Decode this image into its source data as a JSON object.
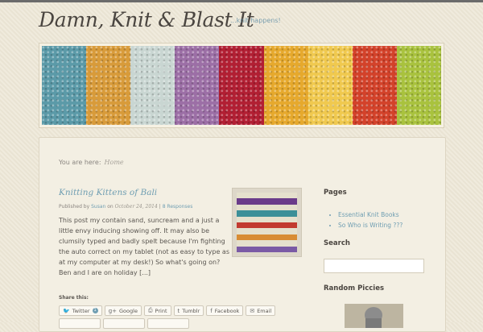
{
  "site": {
    "title": "Damn, Knit & Blast It",
    "tagline": "...knit happens!"
  },
  "banner": {
    "tiles": [
      "#5b9aa8",
      "#d89b3a",
      "#c9d6d2",
      "#9c6fa6",
      "#b21f33",
      "#e6a92d",
      "#f0c94f",
      "#d3422a",
      "#a9c23e"
    ]
  },
  "breadcrumb": {
    "prefix": "You are here:",
    "home": "Home"
  },
  "post": {
    "title": "Knitting Kittens of Bali",
    "meta": {
      "published_by": "Published by",
      "author": "Susan",
      "on": "on",
      "date": "October 24, 2014",
      "separator": "|",
      "responses": "8 Responses"
    },
    "excerpt": "This post my contain sand, suncream and a just a little envy inducing showing off. It may also be clumsily typed and badly spelt because I'm fighting the auto correct on my tablet (not as easy to type as at my computer at my desk!) So what's going on? Ben and I are on holiday [...]",
    "thumb_stripes": [
      "#e5e0cd",
      "#6a3b8a",
      "#e5e0cd",
      "#3c8f98",
      "#e5e0cd",
      "#c23a30",
      "#e5e0cd",
      "#d88c34",
      "#e5e0cd",
      "#7a5aa5"
    ]
  },
  "share": {
    "label": "Share this:",
    "buttons": [
      {
        "label": "Twitter",
        "icon": "twitter-icon",
        "glyph": "🐦",
        "count": "1"
      },
      {
        "label": "Google",
        "icon": "google-plus-icon",
        "glyph": "g+"
      },
      {
        "label": "Print",
        "icon": "printer-icon",
        "glyph": "⎙"
      },
      {
        "label": "Tumblr",
        "icon": "tumblr-icon",
        "glyph": "t"
      },
      {
        "label": "Facebook",
        "icon": "facebook-icon",
        "glyph": "f"
      },
      {
        "label": "Email",
        "icon": "email-icon",
        "glyph": "✉"
      }
    ]
  },
  "sidebar": {
    "pages_heading": "Pages",
    "pages": [
      "Essential Knit Books",
      "So Who is Writing ???"
    ],
    "search_heading": "Search",
    "search_value": "",
    "random_heading": "Random Piccies"
  },
  "colors": {
    "link": "#6f9eb2",
    "text": "#5a5651",
    "background": "#ede7d6"
  }
}
